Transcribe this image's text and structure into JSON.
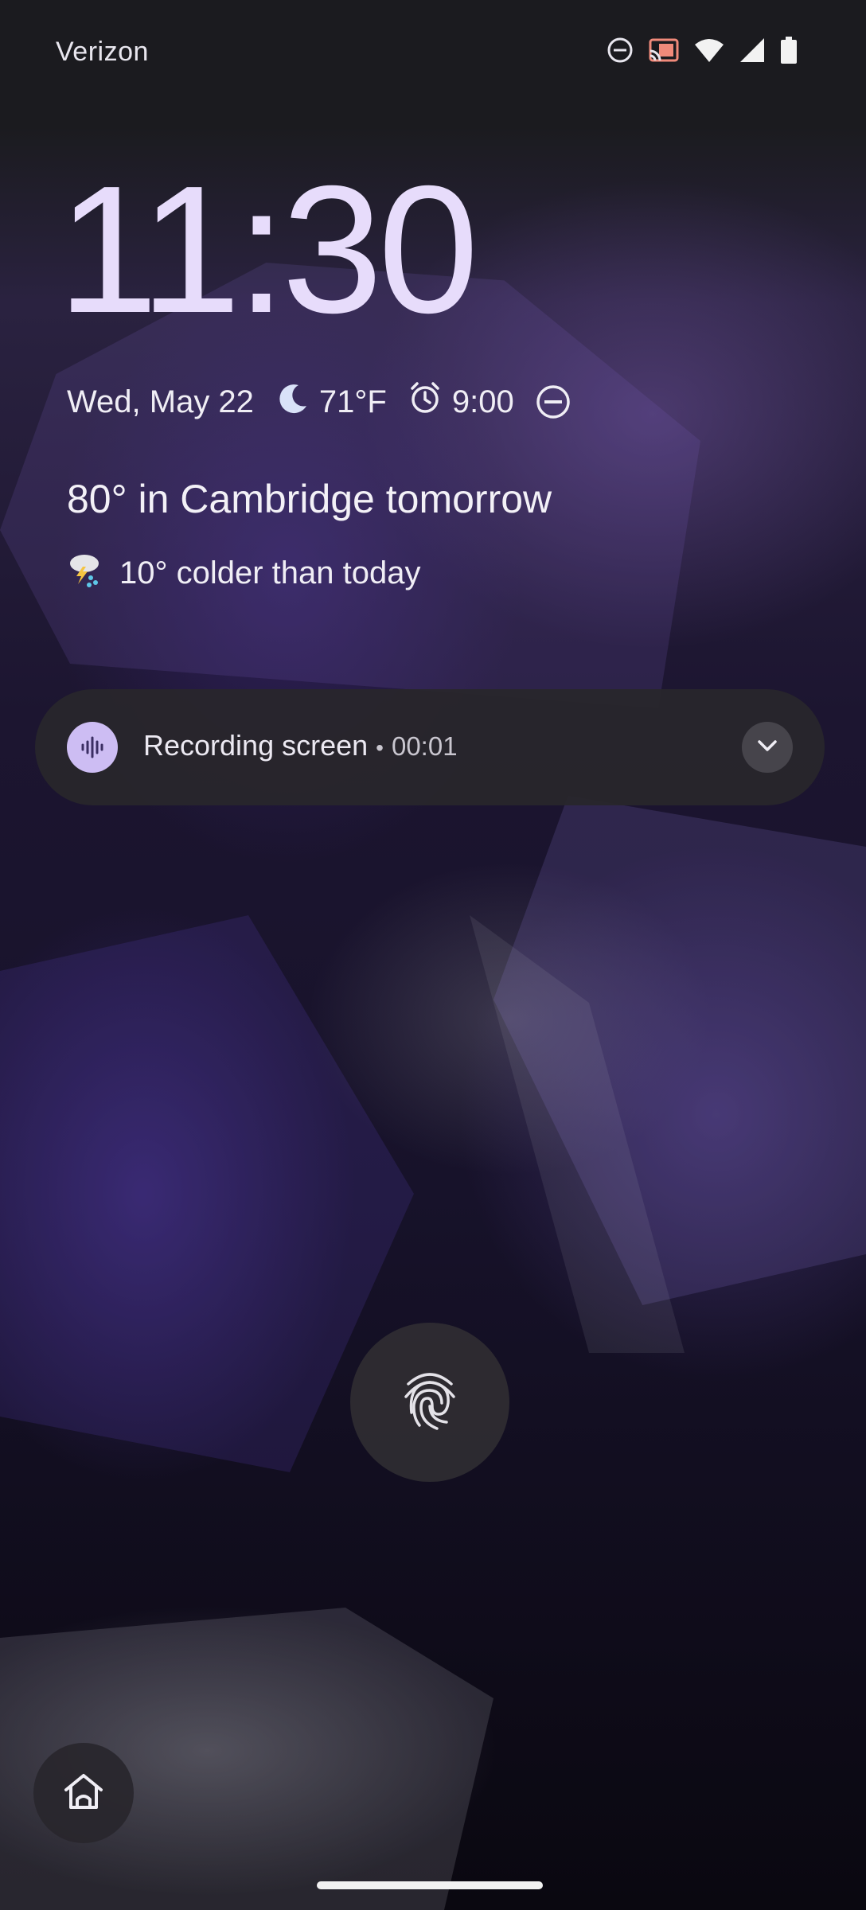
{
  "status_bar": {
    "carrier": "Verizon",
    "icons": [
      "do-not-disturb-icon",
      "cast-icon",
      "wifi-icon",
      "cell-signal-icon",
      "battery-icon"
    ]
  },
  "clock": {
    "time": "11:30"
  },
  "date_row": {
    "date": "Wed, May 22",
    "weather_icon": "moon-icon",
    "temperature": "71°F",
    "alarm_icon": "alarm-clock-icon",
    "alarm_time": "9:00",
    "dnd_icon": "do-not-disturb-icon"
  },
  "weather": {
    "headline": "80° in Cambridge tomorrow",
    "icon": "thunderstorm-icon",
    "detail": "10° colder than today"
  },
  "notification": {
    "icon": "sound-wave-icon",
    "title": "Recording screen",
    "separator": "•",
    "elapsed": "00:01",
    "expand_icon": "chevron-down-icon"
  },
  "lock": {
    "icon": "fingerprint-icon"
  },
  "shortcut": {
    "icon": "home-icon"
  },
  "colors": {
    "clock": "#e7dcfb",
    "notification_bg": "#28262c",
    "notification_icon_bg": "#cdbdf3",
    "text": "#f0eef5"
  }
}
